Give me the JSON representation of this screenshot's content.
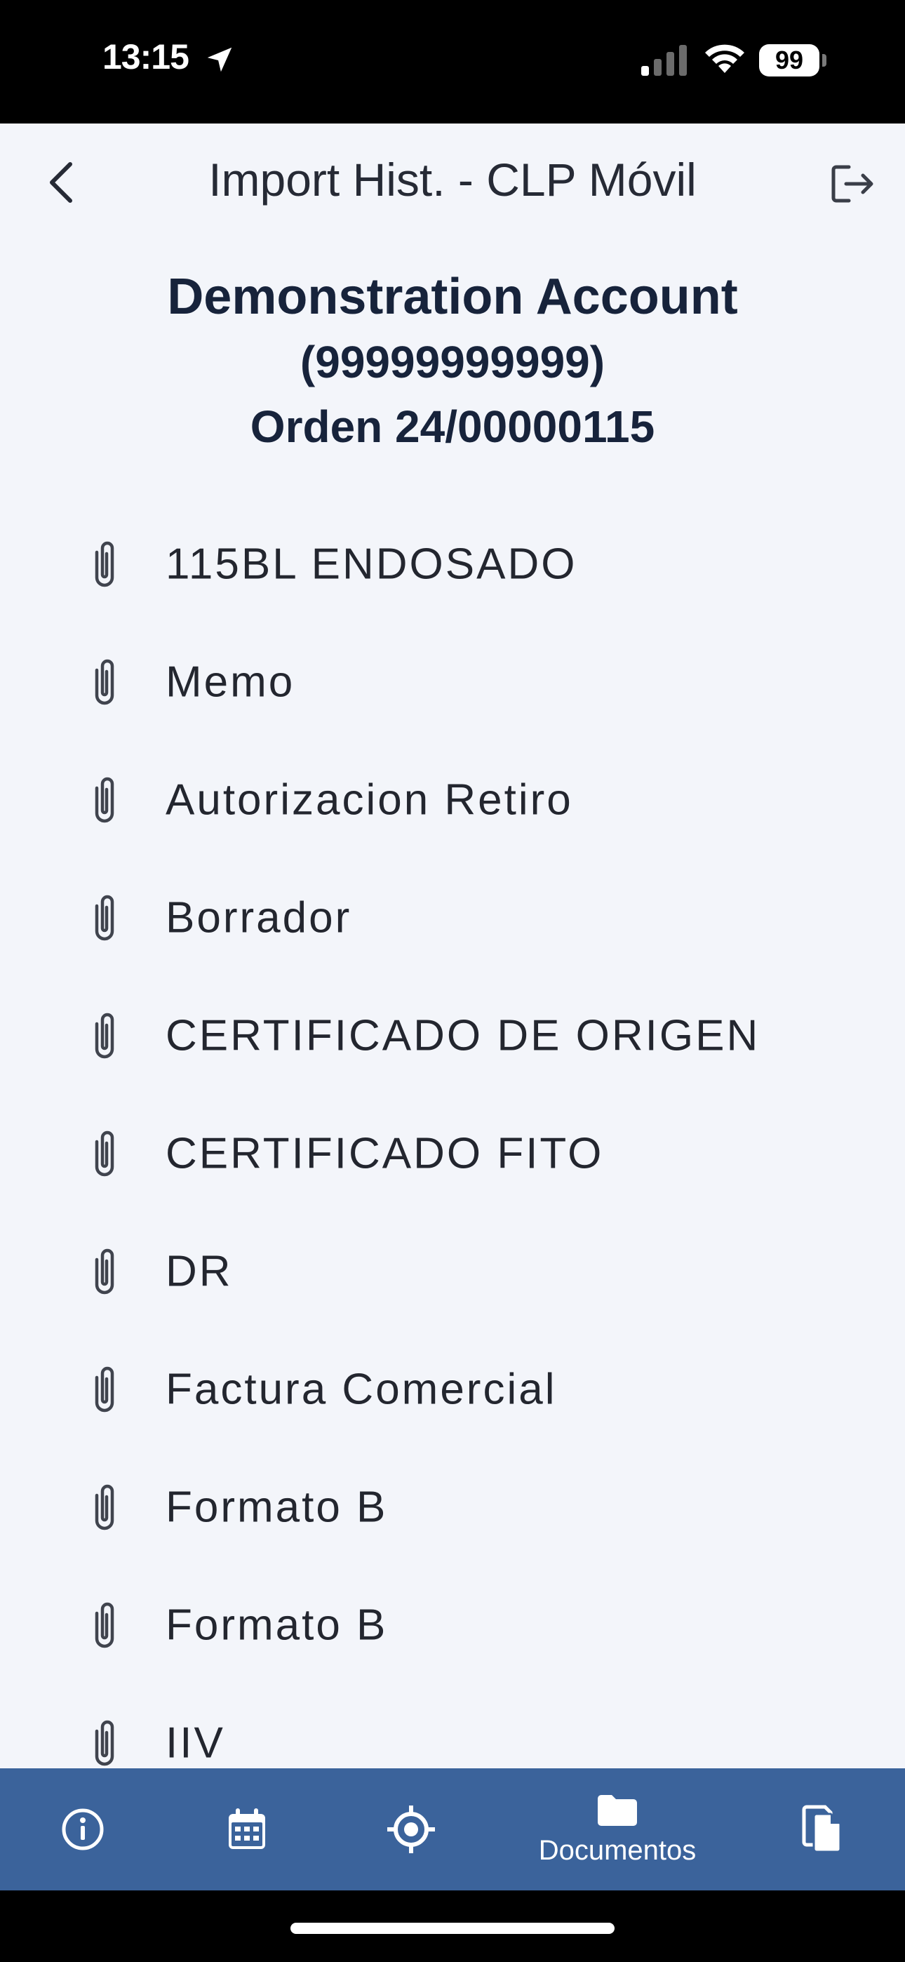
{
  "status_bar": {
    "time": "13:15",
    "battery": "99",
    "icons": [
      "location-arrow-icon",
      "signal-icon",
      "wifi-icon",
      "battery-icon"
    ]
  },
  "header": {
    "title": "Import Hist. - CLP Móvil",
    "back_icon": "chevron-left-icon",
    "logout_icon": "logout-icon"
  },
  "account": {
    "name": "Demonstration Account",
    "id": "(99999999999)",
    "order": "Orden 24/00000115"
  },
  "documents": [
    {
      "label": "115BL ENDOSADO"
    },
    {
      "label": "Memo"
    },
    {
      "label": "Autorizacion Retiro"
    },
    {
      "label": "Borrador"
    },
    {
      "label": "CERTIFICADO DE ORIGEN"
    },
    {
      "label": "CERTIFICADO FITO"
    },
    {
      "label": "DR"
    },
    {
      "label": "Factura Comercial"
    },
    {
      "label": "Formato B"
    },
    {
      "label": "Formato B"
    },
    {
      "label": "IIV"
    }
  ],
  "bottom_nav": {
    "items": [
      {
        "icon": "info-icon",
        "label": ""
      },
      {
        "icon": "calendar-icon",
        "label": ""
      },
      {
        "icon": "location-target-icon",
        "label": ""
      },
      {
        "icon": "folder-icon",
        "label": "Documentos"
      },
      {
        "icon": "copy-document-icon",
        "label": ""
      }
    ]
  },
  "colors": {
    "background": "#f3f5fa",
    "nav_background": "#3b639b",
    "account_text": "#17233b",
    "status_bar": "#000000"
  }
}
